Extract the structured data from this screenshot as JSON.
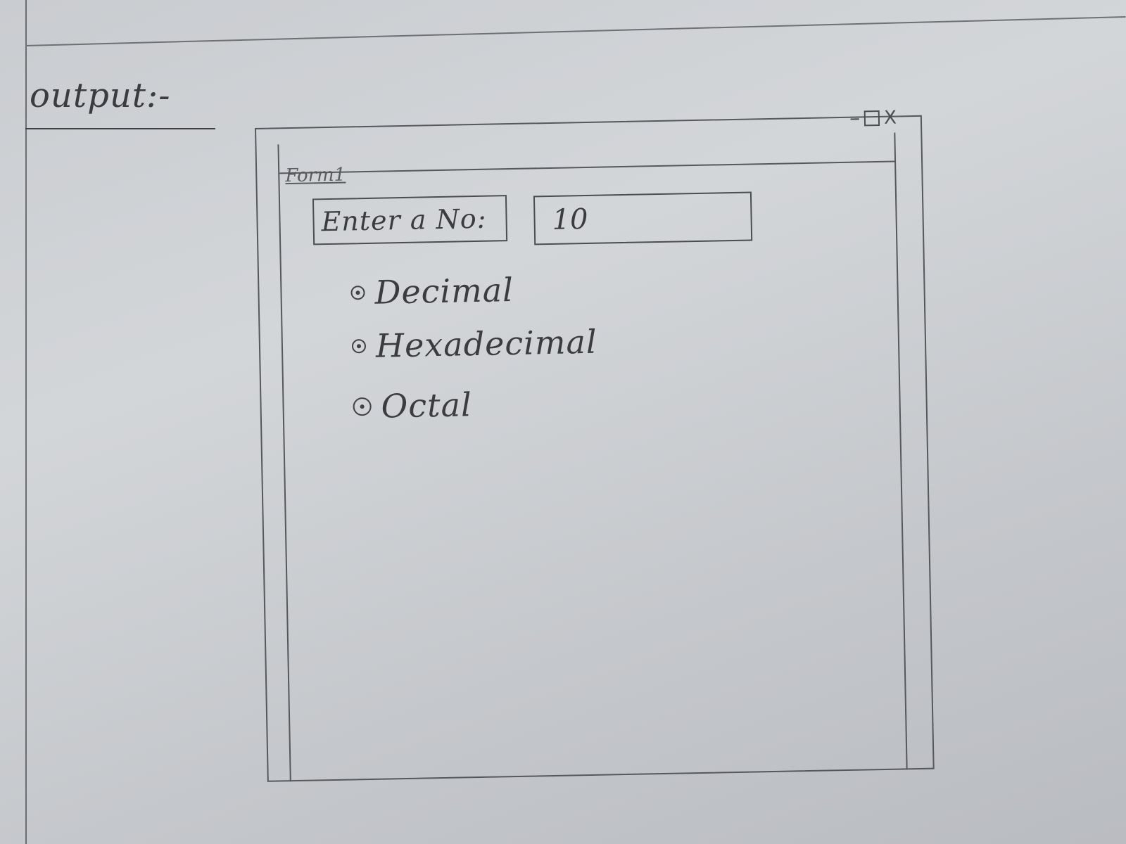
{
  "page": {
    "heading": "output:-"
  },
  "window": {
    "title": "Form1",
    "controls": {
      "minimize": "–",
      "close": "X"
    },
    "input_label": "Enter a No:",
    "input_value": "10",
    "radios": [
      {
        "label": "Decimal"
      },
      {
        "label": "Hexadecimal"
      },
      {
        "label": "Octal"
      }
    ]
  },
  "colors": {
    "paper": "#c9ccd0",
    "ink": "#3a3c40"
  }
}
